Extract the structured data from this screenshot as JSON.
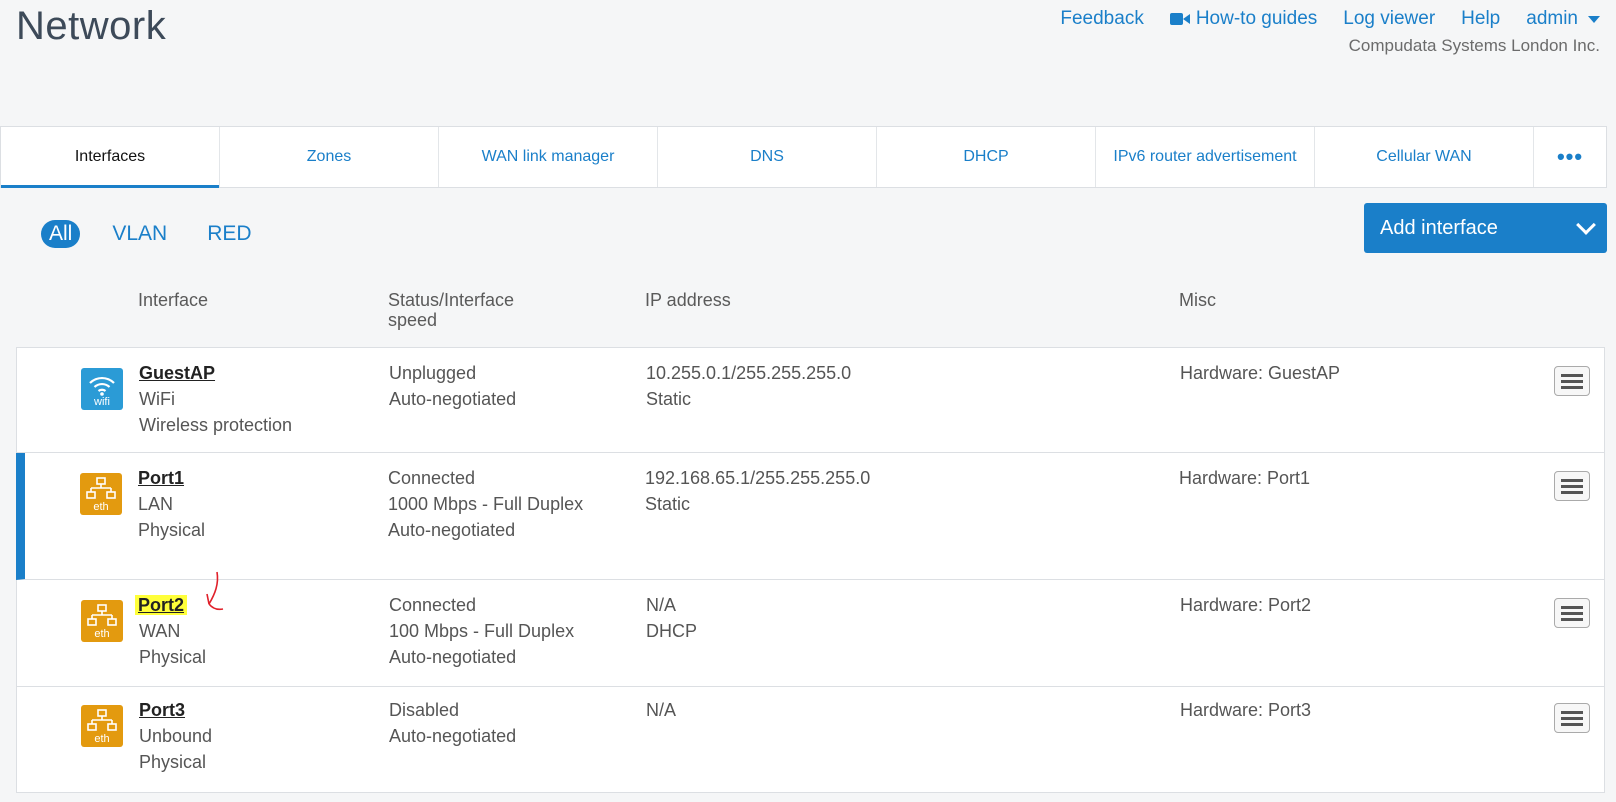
{
  "page": {
    "title": "Network"
  },
  "header": {
    "links": [
      "Feedback",
      "How-to guides",
      "Log viewer",
      "Help",
      "admin"
    ],
    "company": "Compudata Systems London Inc."
  },
  "tabs": [
    "Interfaces",
    "Zones",
    "WAN link manager",
    "DNS",
    "DHCP",
    "IPv6 router advertisement",
    "Cellular WAN",
    "•••"
  ],
  "filters": [
    "All",
    "VLAN",
    "RED"
  ],
  "add_button": "Add interface",
  "columns": {
    "interface": "Interface",
    "status": "Status/Interface speed",
    "ip": "IP address",
    "misc": "Misc"
  },
  "rows": [
    {
      "icon": "wifi",
      "name": "GuestAP",
      "zone": "WiFi",
      "type": "Wireless protection",
      "status": [
        "Unplugged",
        "Auto-negotiated"
      ],
      "ip": [
        "10.255.0.1/255.255.255.0",
        "Static"
      ],
      "hardware": "Hardware:  GuestAP"
    },
    {
      "icon": "eth",
      "name": "Port1",
      "zone": "LAN",
      "type": "Physical",
      "status": [
        "Connected",
        "1000 Mbps - Full Duplex",
        "Auto-negotiated"
      ],
      "ip": [
        "192.168.65.1/255.255.255.0",
        "Static"
      ],
      "hardware": "Hardware:  Port1"
    },
    {
      "icon": "eth",
      "name": "Port2",
      "zone": "WAN",
      "type": "Physical",
      "status": [
        "Connected",
        "100 Mbps - Full Duplex",
        "Auto-negotiated"
      ],
      "ip": [
        "N/A",
        "DHCP"
      ],
      "hardware": "Hardware:  Port2"
    },
    {
      "icon": "eth",
      "name": "Port3",
      "zone": "Unbound",
      "type": "Physical",
      "status": [
        "Disabled",
        "Auto-negotiated"
      ],
      "ip": [
        "N/A"
      ],
      "hardware": "Hardware:  Port3"
    }
  ],
  "icon_labels": {
    "wifi": "wifi",
    "eth": "eth"
  },
  "colors": {
    "accent": "#1a7fc9",
    "eth_icon": "#e39a0f",
    "wifi_icon": "#2b9bd6",
    "highlight": "#ffff3a"
  }
}
